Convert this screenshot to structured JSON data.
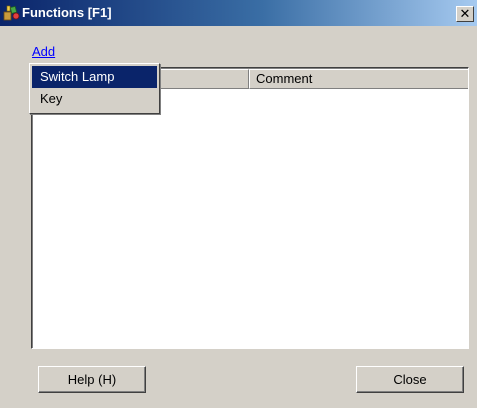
{
  "window": {
    "title": "Functions [F1]",
    "icon": "functions-app-icon",
    "close_glyph": "✕",
    "close_icon": "close-icon"
  },
  "toolbar": {
    "add_label": "Add"
  },
  "list": {
    "columns": [
      "",
      "Comment"
    ],
    "rows": []
  },
  "menu": {
    "items": [
      {
        "label": "Switch Lamp",
        "selected": true
      },
      {
        "label": "Key",
        "selected": false
      }
    ]
  },
  "buttons": {
    "help_label": "Help (H)",
    "close_label": "Close"
  },
  "colors": {
    "titlebar_start": "#0a246a",
    "titlebar_end": "#a6caf0",
    "dialog_face": "#d4d0c8",
    "link": "#0000ff",
    "menu_highlight": "#0a246a"
  }
}
